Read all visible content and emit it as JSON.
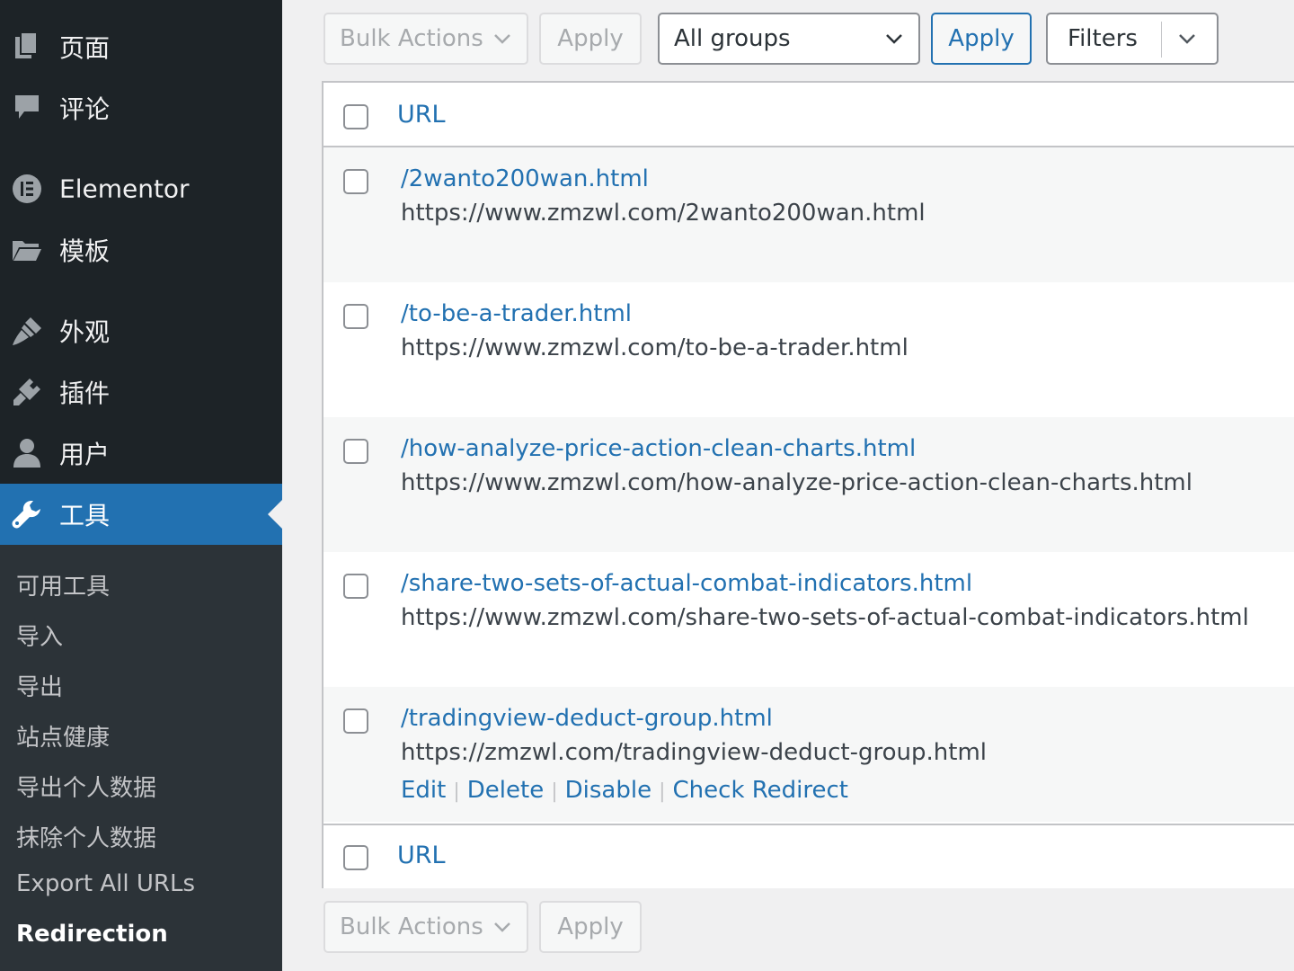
{
  "sidebar": {
    "menu": [
      {
        "label": "页面",
        "icon": "pages-icon"
      },
      {
        "label": "评论",
        "icon": "comments-icon"
      },
      {
        "label": "Elementor",
        "icon": "elementor-icon"
      },
      {
        "label": "模板",
        "icon": "folder-icon"
      },
      {
        "label": "外观",
        "icon": "appearance-brush-icon"
      },
      {
        "label": "插件",
        "icon": "plugins-plug-icon"
      },
      {
        "label": "用户",
        "icon": "users-icon"
      },
      {
        "label": "工具",
        "icon": "tools-wrench-icon",
        "active": true
      }
    ],
    "submenu": [
      {
        "label": "可用工具"
      },
      {
        "label": "导入"
      },
      {
        "label": "导出"
      },
      {
        "label": "站点健康"
      },
      {
        "label": "导出个人数据"
      },
      {
        "label": "抹除个人数据"
      },
      {
        "label": "Export All URLs"
      },
      {
        "label": "Redirection",
        "current": true
      }
    ]
  },
  "top_nav": {
    "bulk_actions": "Bulk Actions",
    "apply": "Apply",
    "group_select": "All groups",
    "group_apply": "Apply",
    "filters": "Filters"
  },
  "table": {
    "column_header": "URL",
    "column_footer": "URL",
    "rows": [
      {
        "source": "/2wanto200wan.html",
        "target": "https://www.zmzwl.com/2wanto200wan.html"
      },
      {
        "source": "/to-be-a-trader.html",
        "target": "https://www.zmzwl.com/to-be-a-trader.html"
      },
      {
        "source": "/how-analyze-price-action-clean-charts.html",
        "target": "https://www.zmzwl.com/how-analyze-price-action-clean-charts.html"
      },
      {
        "source": "/share-two-sets-of-actual-combat-indicators.html",
        "target": "https://www.zmzwl.com/share-two-sets-of-actual-combat-indicators.html"
      },
      {
        "source": "/tradingview-deduct-group.html",
        "target": "https://zmzwl.com/tradingview-deduct-group.html"
      }
    ],
    "row_actions": {
      "edit": "Edit",
      "delete": "Delete",
      "disable": "Disable",
      "check_redirect": "Check Redirect"
    }
  },
  "bottom_nav": {
    "bulk_actions": "Bulk Actions",
    "apply": "Apply"
  },
  "colors": {
    "sidebar_bg": "#1d2327",
    "submenu_bg": "#2c3338",
    "accent": "#2271b1",
    "page_bg": "#f0f0f1"
  }
}
